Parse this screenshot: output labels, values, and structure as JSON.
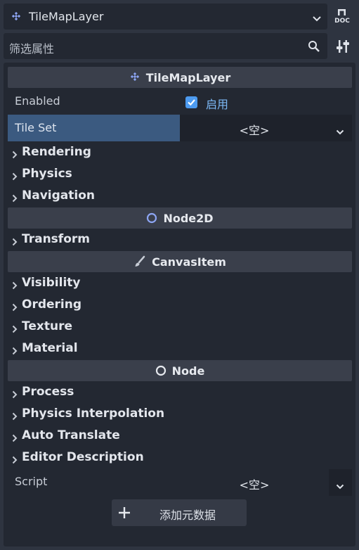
{
  "top_selector": {
    "title": "TileMapLayer",
    "icon": "tilemaplayer-icon"
  },
  "doc_button": {
    "label": "DOC"
  },
  "filter": {
    "placeholder": "筛选属性"
  },
  "sections": {
    "tilemaplayer": {
      "title": "TileMapLayer"
    },
    "node2d": {
      "title": "Node2D"
    },
    "canvasitem": {
      "title": "CanvasItem"
    },
    "node": {
      "title": "Node"
    }
  },
  "properties": {
    "enabled": {
      "label": "Enabled",
      "checked": true,
      "value_label": "启用"
    },
    "tile_set": {
      "label": "Tile Set",
      "value": "<空>"
    },
    "script": {
      "label": "Script",
      "value": "<空>"
    }
  },
  "categories": {
    "tilemaplayer": [
      "Rendering",
      "Physics",
      "Navigation"
    ],
    "node2d": [
      "Transform"
    ],
    "canvasitem": [
      "Visibility",
      "Ordering",
      "Texture",
      "Material"
    ],
    "node": [
      "Process",
      "Physics Interpolation",
      "Auto Translate",
      "Editor Description"
    ]
  },
  "add_metadata": {
    "label": "添加元数据"
  },
  "colors": {
    "background": "#2e3440",
    "panel": "#232832",
    "section_header": "#3a3f4b",
    "selected_property": "#3b5a80",
    "accent": "#4d9bf0",
    "node2d_icon": "#8da5f3"
  }
}
